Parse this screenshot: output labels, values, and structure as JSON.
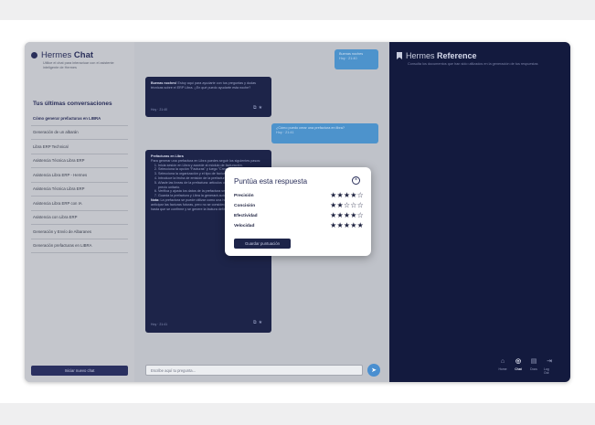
{
  "sidebar": {
    "brand_light": "Hermes",
    "brand_bold": "Chat",
    "subtitle": "Utilice el chat para interactuar con el asistente inteligente de Hermes",
    "conversations_title": "Tus últimas conversaciones",
    "conversations": [
      "Cómo generar prefacturas en LIBRA",
      "Generación de un albarán",
      "Libra ERP Technical",
      "Asistencia Técnica Libra ERP",
      "Asistencia Libra ERP - Hermes",
      "Asistencia Técnica Libra ERP",
      "Asistencia Libra ERP con IA",
      "Asistencia con Libra ERP",
      "Generación y Envío de Albaranes",
      "Generación prefacturas en LIBRA"
    ],
    "new_chat_label": "Iniciar nuevo chat"
  },
  "chat": {
    "messages": [
      {
        "role": "user",
        "text": "Buenas noches",
        "meta": "Hoy · 21:40"
      },
      {
        "role": "bot",
        "bold": "Buenas noches!",
        "text": "Estoy aquí para ayudarte con tus preguntas y dudas técnicas sobre el ERP Libra. ¿En qué puedo ayudarte esta noche?",
        "meta": "Hoy · 21:40"
      },
      {
        "role": "user",
        "text": "¿Cómo puedo crear una prefactura en libra?",
        "meta": "Hoy · 21:41"
      },
      {
        "role": "bot",
        "bold": "Prefacturas en Libra",
        "intro": "Para generar una prefactura en Libra puedes seguir los siguientes pasos:",
        "steps": [
          "Inicia sesión en Libra y accede al módulo de facturación.",
          "Selecciona la opción \"Facturas\" y luego \"Crear prefactura\".",
          "Selecciona la organización y el tipo de factura que deseas crear.",
          "Introduce la fecha de emisión de la prefactura y el importe total.",
          "Añade las líneas de la prefactura: artículos o servicios, cantidad y precio unitario.",
          "Verifica y ajusta los datos de la prefactura según sea necesario.",
          "Guarda la prefactura y Libra la generará automáticamente."
        ],
        "note_bold": "Nota:",
        "note": "La prefactura se puede utilizar como una herramienta para planificar y anticipar las facturas futuras, pero no se considera como una factura oficial hasta que se confirme y se genere la factura definitiva.",
        "meta": "Hoy · 21:41"
      }
    ],
    "input_placeholder": "Escribe aquí tu pregunta..."
  },
  "reference": {
    "title_light": "Hermes",
    "title_bold": "Reference",
    "subtitle": "Consulta los documentos que han sido utilizados en la generación de tus respuestas",
    "nav": [
      {
        "icon": "home-icon",
        "glyph": "⌂",
        "label": "Home",
        "active": false
      },
      {
        "icon": "chat-icon",
        "glyph": "◎",
        "label": "Chat",
        "active": true
      },
      {
        "icon": "docs-icon",
        "glyph": "▤",
        "label": "Docs",
        "active": false
      },
      {
        "icon": "logout-icon",
        "glyph": "⇥",
        "label": "Log Out",
        "active": false
      }
    ]
  },
  "modal": {
    "title": "Puntúa esta respuesta",
    "criteria": [
      {
        "label": "Precisión",
        "rating": 4,
        "max": 5
      },
      {
        "label": "Concisión",
        "rating": 2,
        "max": 5
      },
      {
        "label": "Efectividad",
        "rating": 4,
        "max": 5
      },
      {
        "label": "Velocidad",
        "rating": 5,
        "max": 5
      }
    ],
    "submit_label": "Guardar puntuación"
  },
  "colors": {
    "navy": "#1d2449",
    "accent_blue": "#4d93cc",
    "reference_bg": "#131a3e"
  }
}
